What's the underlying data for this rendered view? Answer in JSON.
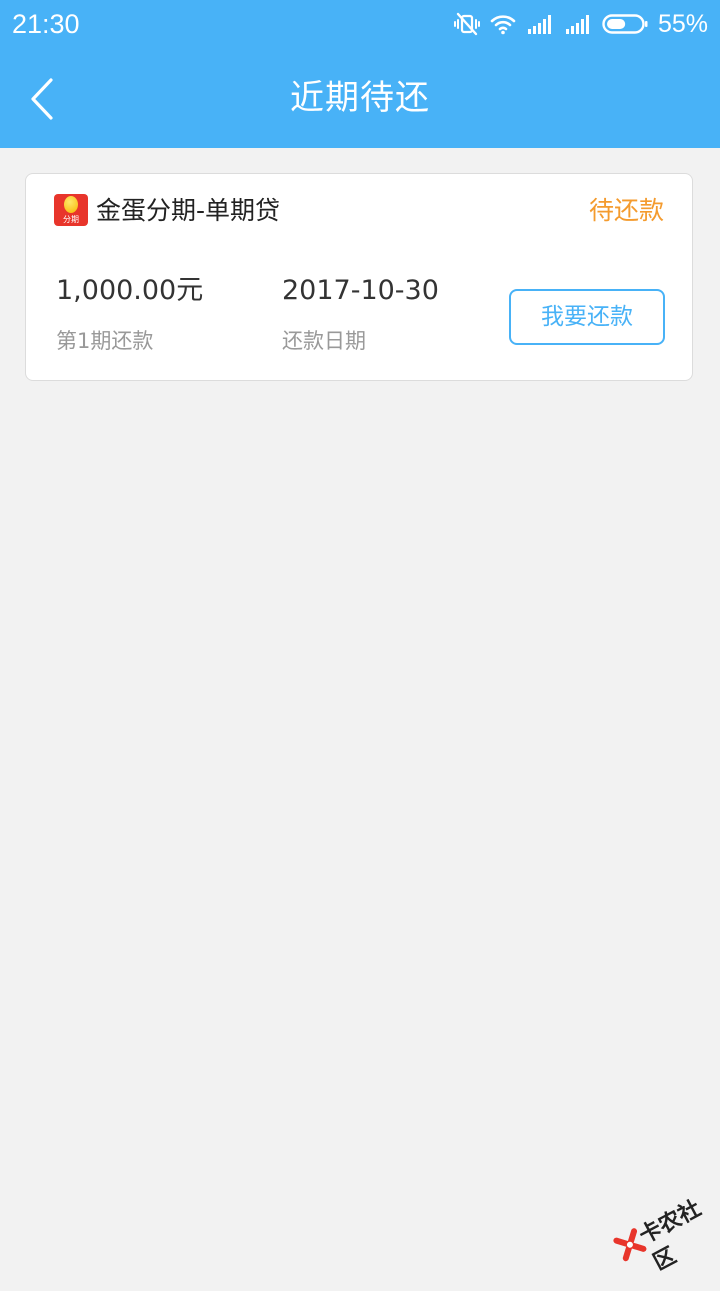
{
  "status_bar": {
    "time": "21:30",
    "battery_percent": "55%",
    "battery_level": 0.55,
    "icons": [
      "vibrate-off-icon",
      "wifi-icon",
      "signal-icon",
      "signal-icon",
      "battery-icon"
    ]
  },
  "header": {
    "title": "近期待还",
    "back_icon": "chevron-left-icon"
  },
  "card": {
    "product_name": "金蛋分期-单期贷",
    "logo_text": "分期",
    "status": "待还款",
    "amount": "1,000.00元",
    "amount_label": "第1期还款",
    "date": "2017-10-30",
    "date_label": "还款日期",
    "repay_button": "我要还款"
  },
  "watermark": {
    "text": "卡农社区"
  },
  "colors": {
    "primary": "#48b2f7",
    "background": "#f2f2f2",
    "status_orange": "#f49b2e",
    "logo_red": "#e8352b"
  }
}
